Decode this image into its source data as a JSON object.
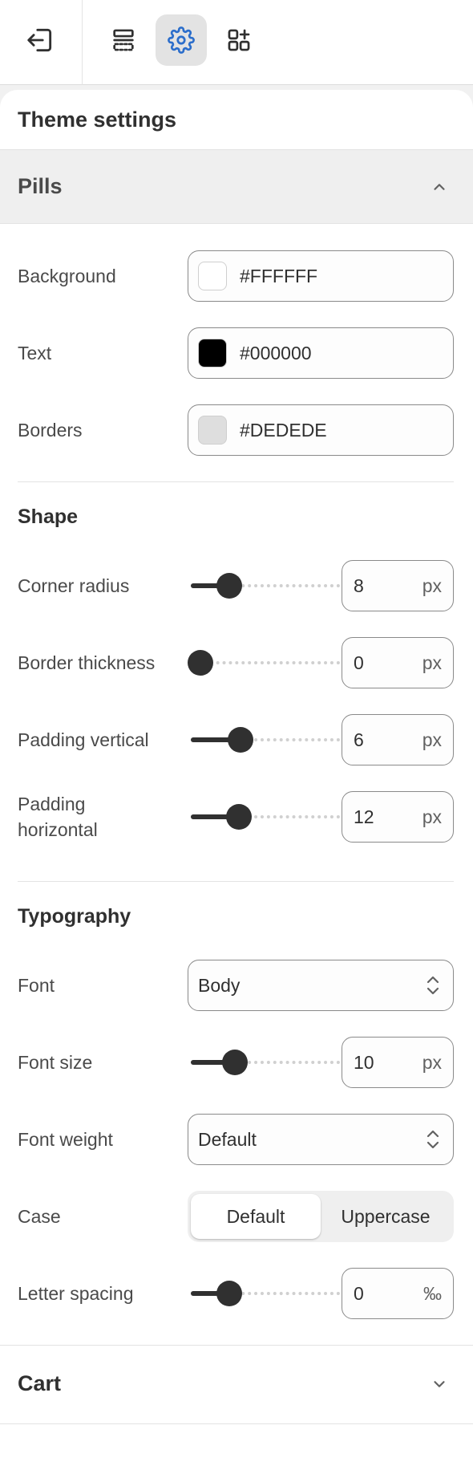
{
  "toolbar": {
    "exit_icon": "exit-icon",
    "tools": [
      {
        "icon": "sections-icon",
        "active": false
      },
      {
        "icon": "gear-icon",
        "active": true
      },
      {
        "icon": "add-block-icon",
        "active": false
      }
    ],
    "accent_color": "#2c6ecb"
  },
  "panel": {
    "title": "Theme settings",
    "section": {
      "label": "Pills",
      "expanded": true
    },
    "colors": [
      {
        "label": "Background",
        "value": "#FFFFFF",
        "swatch": "#FFFFFF"
      },
      {
        "label": "Text",
        "value": "#000000",
        "swatch": "#000000"
      },
      {
        "label": "Borders",
        "value": "#DEDEDE",
        "swatch": "#DEDEDE"
      }
    ],
    "shape": {
      "heading": "Shape",
      "corner_radius": {
        "label": "Corner radius",
        "value": "8",
        "unit": "px",
        "level": 0.2
      },
      "border_thickness": {
        "label": "Border thickness",
        "value": "0",
        "unit": "px",
        "level": 0.0
      },
      "padding_vertical": {
        "label": "Padding vertical",
        "value": "6",
        "unit": "px",
        "level": 0.28
      },
      "padding_horizontal": {
        "label": "Padding horizontal",
        "value": "12",
        "unit": "px",
        "level": 0.27
      }
    },
    "typography": {
      "heading": "Typography",
      "font": {
        "label": "Font",
        "value": "Body"
      },
      "font_size": {
        "label": "Font size",
        "value": "10",
        "unit": "px",
        "level": 0.24
      },
      "font_weight": {
        "label": "Font weight",
        "value": "Default"
      },
      "case": {
        "label": "Case",
        "options": [
          "Default",
          "Uppercase"
        ],
        "selected": "Default"
      },
      "letter_spacing": {
        "label": "Letter spacing",
        "value": "0",
        "unit": "‰",
        "level": 0.2
      }
    },
    "next_section": {
      "label": "Cart",
      "expanded": false
    }
  }
}
